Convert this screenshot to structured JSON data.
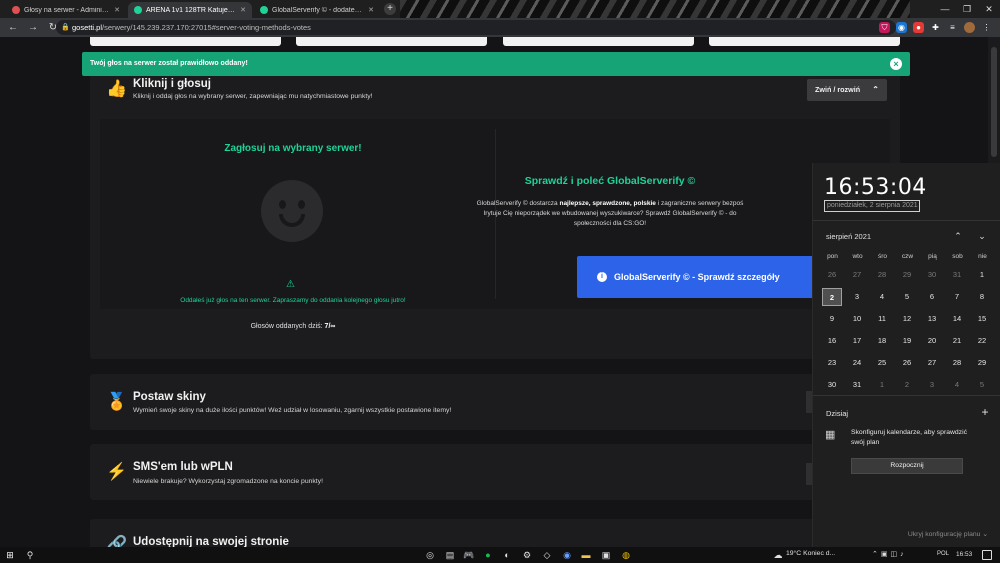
{
  "browser": {
    "tabs": [
      {
        "title": "Głosy na serwer - Administracji",
        "active": false,
        "favicon_color": "#e05050"
      },
      {
        "title": "ARENA 1v1 128TR Katujemy.eu",
        "active": true,
        "favicon_color": "#1fd397"
      },
      {
        "title": "GlobalServerify © - dodatek do",
        "active": false,
        "favicon_color": "#1fd397"
      }
    ],
    "new_tab_glyph": "+",
    "url_host": "gosetti.pl",
    "url_path": "/serwery/145.239.237.170:27015#server-voting-methods-votes"
  },
  "alert": {
    "message": "Twój głos na serwer został prawidłowo oddany!",
    "close_glyph": "×",
    "color": "#16a376"
  },
  "vote_card": {
    "title": "Kliknij i głosuj",
    "description": "Kliknij i oddaj głos na wybrany serwer, zapewniając mu natychmiastowe punkty!",
    "toggle_label": "Zwiń / rozwiń",
    "icon": "thumbs-up-icon"
  },
  "vote_panel": {
    "title": "Zagłosuj na wybrany serwer!",
    "warning": "Oddałeś już głos na ten serwer. Zapraszamy do oddania kolejnego głosu jutro!",
    "count_label": "Głosów oddanych dziś:",
    "count_value": "7/∞"
  },
  "globalserverify": {
    "title": "Sprawdź i poleć GlobalServerify ©",
    "body_1": "GlobalServerify © dostarcza ",
    "body_bold": "najlepsze, sprawdzone, polskie",
    "body_2": " i zagraniczne serwery bezpoś",
    "body_3": "Irytuje Cię nieporządek we wbudowanej wyszukiwarce? Sprawdź GlobalServerify © - do",
    "body_4": "społeczności dla CS:GO!",
    "button_label": "GlobalServerify © - Sprawdź szczegóły",
    "button_color": "#2d63e8"
  },
  "cards": [
    {
      "title": "Postaw skiny",
      "description": "Wymień swoje skiny na duże ilości punktów! Weź udział w losowaniu, zgarnij wszystkie postawione itemy!",
      "icon": "award-icon"
    },
    {
      "title": "SMS'em lub wPLN",
      "description": "Niewiele brakuje? Wykorzystaj zgromadzone na koncie punkty!",
      "icon": "lightning-icon"
    },
    {
      "title": "Udostępnij na swojej stronie",
      "description": "",
      "icon": "link-icon"
    }
  ],
  "calendar": {
    "time": "16:53:04",
    "date": "poniedziałek, 2 sierpnia 2021",
    "month": "sierpień 2021",
    "weekdays": [
      "pon",
      "wto",
      "śro",
      "czw",
      "pią",
      "sob",
      "nie"
    ],
    "weeks": [
      [
        "26",
        "27",
        "28",
        "29",
        "30",
        "31",
        "1"
      ],
      [
        "2",
        "3",
        "4",
        "5",
        "6",
        "7",
        "8"
      ],
      [
        "9",
        "10",
        "11",
        "12",
        "13",
        "14",
        "15"
      ],
      [
        "16",
        "17",
        "18",
        "19",
        "20",
        "21",
        "22"
      ],
      [
        "23",
        "24",
        "25",
        "26",
        "27",
        "28",
        "29"
      ],
      [
        "30",
        "31",
        "1",
        "2",
        "3",
        "4",
        "5"
      ]
    ],
    "today": "2",
    "today_label": "Dzisiaj",
    "configure_text": "Skonfiguruj kalendarze, aby sprawdzić swój plan",
    "start_button": "Rozpocznij",
    "hide_plan": "Ukryj konfigurację planu ⌄"
  },
  "taskbar": {
    "weather": "19°C  Koniec d...",
    "language": "POL",
    "time": "16:53"
  },
  "colors": {
    "accent": "#1fd397",
    "background": "#141416",
    "card": "#1c1c1e"
  }
}
